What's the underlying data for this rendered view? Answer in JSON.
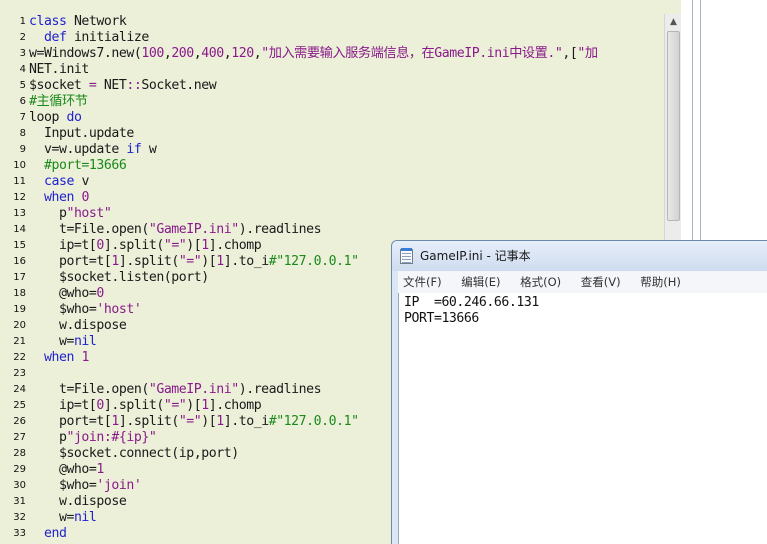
{
  "editor": {
    "lines": [
      {
        "n": "1",
        "html": "<span class=\"kw\">class</span> Network"
      },
      {
        "n": "2",
        "html": "  <span class=\"kw\">def</span> initialize"
      },
      {
        "n": "3",
        "html": "w=Windows7.new(<span class=\"num-lit\">100</span>,<span class=\"num-lit\">200</span>,<span class=\"num-lit\">400</span>,<span class=\"num-lit\">120</span>,<span class=\"str\">\"加入需要输入服务端信息，在GameIP.ini中设置.\"</span>,[<span class=\"str\">\"加</span>"
      },
      {
        "n": "4",
        "html": "NET.init"
      },
      {
        "n": "5",
        "html": "$socket <span class=\"op\">=</span> NET<span class=\"op\">::</span>Socket.new"
      },
      {
        "n": "6",
        "html": "<span class=\"cmt\">#主循环节</span>"
      },
      {
        "n": "7",
        "html": "loop <span class=\"kw\">do</span>"
      },
      {
        "n": "8",
        "html": "  Input.update"
      },
      {
        "n": "9",
        "html": "  v=w.update <span class=\"kw\">if</span> w"
      },
      {
        "n": "10",
        "html": "  <span class=\"cmt\">#port=13666</span>"
      },
      {
        "n": "11",
        "html": "  <span class=\"kw\">case</span> v"
      },
      {
        "n": "12",
        "html": "  <span class=\"kw\">when</span> <span class=\"num-lit\">0</span>"
      },
      {
        "n": "13",
        "html": "    p<span class=\"str\">\"host\"</span>"
      },
      {
        "n": "14",
        "html": "    t=File.open(<span class=\"str\">\"GameIP.ini\"</span>).readlines"
      },
      {
        "n": "15",
        "html": "    ip=t[<span class=\"num-lit\">0</span>].split(<span class=\"str\">\"=\"</span>)[<span class=\"num-lit\">1</span>].chomp"
      },
      {
        "n": "16",
        "html": "    port=t[<span class=\"num-lit\">1</span>].split(<span class=\"str\">\"=\"</span>)[<span class=\"num-lit\">1</span>].to_i<span class=\"cmt\">#\"127.0.0.1\"</span>"
      },
      {
        "n": "17",
        "html": "    $socket.listen(port)"
      },
      {
        "n": "18",
        "html": "    @who=<span class=\"num-lit\">0</span>"
      },
      {
        "n": "19",
        "html": "    $who=<span class=\"str\">'host'</span>"
      },
      {
        "n": "20",
        "html": "    w.dispose"
      },
      {
        "n": "21",
        "html": "    w=<span class=\"kw\">nil</span>"
      },
      {
        "n": "22",
        "html": "  <span class=\"kw\">when</span> <span class=\"num-lit\">1</span>"
      },
      {
        "n": "23",
        "html": ""
      },
      {
        "n": "24",
        "html": "    t=File.open(<span class=\"str\">\"GameIP.ini\"</span>).readlines"
      },
      {
        "n": "25",
        "html": "    ip=t[<span class=\"num-lit\">0</span>].split(<span class=\"str\">\"=\"</span>)[<span class=\"num-lit\">1</span>].chomp"
      },
      {
        "n": "26",
        "html": "    port=t[<span class=\"num-lit\">1</span>].split(<span class=\"str\">\"=\"</span>)[<span class=\"num-lit\">1</span>].to_i<span class=\"cmt\">#\"127.0.0.1\"</span>"
      },
      {
        "n": "27",
        "html": "    p<span class=\"str\">\"join:#{ip}\"</span>"
      },
      {
        "n": "28",
        "html": "    $socket.connect(ip,port)"
      },
      {
        "n": "29",
        "html": "    @who=<span class=\"num-lit\">1</span>"
      },
      {
        "n": "30",
        "html": "    $who=<span class=\"str\">'join'</span>"
      },
      {
        "n": "31",
        "html": "    w.dispose"
      },
      {
        "n": "32",
        "html": "    w=<span class=\"kw\">nil</span>"
      },
      {
        "n": "33",
        "html": "  <span class=\"kw\">end</span>"
      }
    ],
    "scroll_up_glyph": "▲"
  },
  "notepad": {
    "title": "GameIP.ini - 记事本",
    "menu": [
      "文件(F)",
      "编辑(E)",
      "格式(O)",
      "查看(V)",
      "帮助(H)"
    ],
    "content": [
      "IP  =60.246.66.131",
      "PORT=13666"
    ]
  },
  "colors": {
    "editor_bg": "#ecf0d9",
    "keyword": "#1f1fd0",
    "string": "#8a1a8a",
    "comment": "#1a8a1a",
    "notepad_frame": "#dbe7f5"
  },
  "icons": {
    "notepad_icon": "notepad-icon",
    "scroll_up": "scroll-up-arrow-icon"
  }
}
